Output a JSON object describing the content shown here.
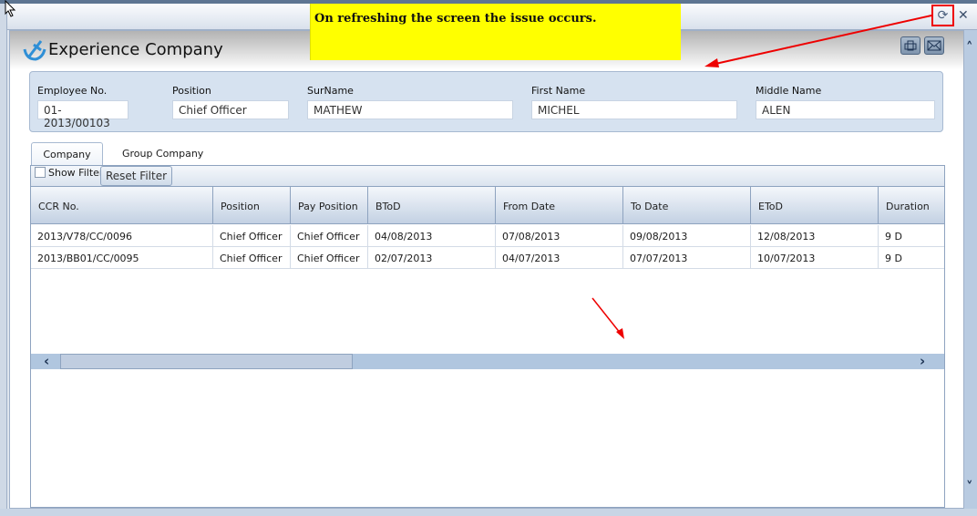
{
  "annotation": {
    "note": "On refreshing the screen the issue occurs."
  },
  "window": {
    "title": "Experience Company"
  },
  "form": {
    "fields": [
      {
        "label": "Employee No.",
        "value": "01-2013/00103"
      },
      {
        "label": "Position",
        "value": "Chief Officer"
      },
      {
        "label": "SurName",
        "value": "MATHEW"
      },
      {
        "label": "First Name",
        "value": "MICHEL"
      },
      {
        "label": "Middle Name",
        "value": "ALEN"
      }
    ]
  },
  "tabs": [
    {
      "label": "Company"
    },
    {
      "label": "Group Company"
    }
  ],
  "toolbar": {
    "show_filter": "Show Filter",
    "reset_filter": "Reset Filter"
  },
  "grid": {
    "columns": [
      "CCR No.",
      "Position",
      "Pay Position",
      "BToD",
      "From Date",
      "To Date",
      "EToD",
      "Duration"
    ],
    "rows": [
      [
        "2013/V78/CC/0096",
        "Chief Officer",
        "Chief Officer",
        "04/08/2013",
        "07/08/2013",
        "09/08/2013",
        "12/08/2013",
        "9 D"
      ],
      [
        "2013/BB01/CC/0095",
        "Chief Officer",
        "Chief Officer",
        "02/07/2013",
        "04/07/2013",
        "07/07/2013",
        "10/07/2013",
        "9 D"
      ]
    ]
  },
  "icons": {
    "scroll_left": "‹",
    "scroll_right": "›",
    "refresh": "⟳",
    "close": "✕",
    "scroll_up": "˄",
    "scroll_down": "˅"
  }
}
